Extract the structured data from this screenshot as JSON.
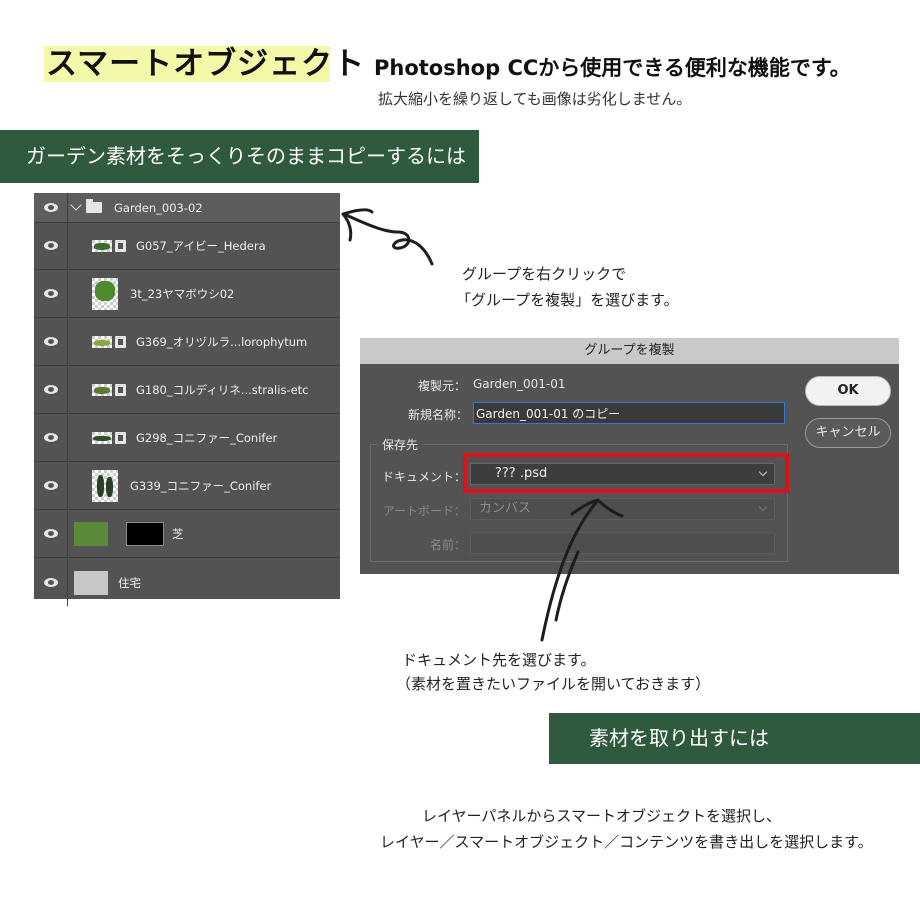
{
  "header": {
    "title": "スマートオブジェクト",
    "subtitle": "Photoshop CCから使用できる便利な機能です。",
    "description": "拡大縮小を繰り返しても画像は劣化しません。"
  },
  "section1": {
    "heading": "ガーデン素材をそっくりそのままコピーするには"
  },
  "layers_panel": {
    "group_name": "Garden_003-02",
    "layers": [
      {
        "name": "G057_アイビー_Hedera"
      },
      {
        "name": "3t_23ヤマボウシ02"
      },
      {
        "name": "G369_オリヅルラ...lorophytum"
      },
      {
        "name": "G180_コルディリネ...stralis-etc"
      },
      {
        "name": "G298_コニファー_Conifer"
      },
      {
        "name": "G339_コニファー_Conifer"
      },
      {
        "name": "芝"
      },
      {
        "name": "住宅"
      }
    ],
    "icons": {
      "visibility": "eye-icon",
      "folder": "folder-icon",
      "expand": "chevron-down-icon",
      "smart_object": "smart-object-badge-icon"
    }
  },
  "annotations": {
    "right_click_line1": "グループを右クリックで",
    "right_click_line2": "「グループを複製」を選びます。",
    "document_line1": "ドキュメント先を選びます。",
    "document_line2": "（素材を置きたいファイルを開いておきます）"
  },
  "dialog": {
    "title": "グループを複製",
    "source_label": "複製元：",
    "source_value": "Garden_001-01",
    "new_name_label": "新規名称：",
    "new_name_value": "Garden_001-01 のコピー",
    "destination_section": "保存先",
    "document_label": "ドキュメント：",
    "document_value": "???        .psd",
    "artboard_label": "アートボード：",
    "artboard_value": "カンバス",
    "name_label": "名前：",
    "name_value": "",
    "ok_button": "OK",
    "cancel_button": "キャンセル",
    "highlight_color": "#d9141a"
  },
  "section2": {
    "heading": "素材を取り出すには",
    "instruction_line1": "レイヤーパネルからスマートオブジェクトを選択し、",
    "instruction_line2": "レイヤー／スマートオブジェクト／コンテンツを書き出しを選択します。"
  },
  "colors": {
    "banner": "#2f5a3e",
    "title_highlight": "#f3f9a8",
    "panel_bg": "#535353"
  }
}
